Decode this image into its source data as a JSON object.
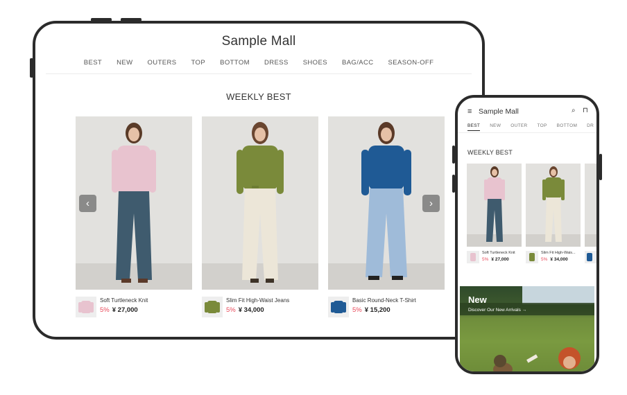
{
  "tablet": {
    "logo": "Sample Mall",
    "nav": [
      "BEST",
      "NEW",
      "OUTERS",
      "TOP",
      "BOTTOM",
      "DRESS",
      "SHOES",
      "BAG/ACC",
      "SEASON-OFF"
    ],
    "heading": "WEEKLY BEST",
    "prev_icon": "‹",
    "next_icon": "›",
    "products": [
      {
        "name": "Soft Turtleneck Knit",
        "discount": "5%",
        "price": "¥ 27,000",
        "top_color": "#e8c3cf",
        "bottom_color": "#3f5b6e"
      },
      {
        "name": "Slim Fit High-Waist Jeans",
        "discount": "5%",
        "price": "¥ 34,000",
        "top_color": "#7a8a3a",
        "bottom_color": "#ece6d8"
      },
      {
        "name": "Basic Round-Neck T-Shirt",
        "discount": "5%",
        "price": "¥ 15,200",
        "top_color": "#1f5a95",
        "bottom_color": "#9fbbd9"
      }
    ]
  },
  "phone": {
    "menu_icon": "≡",
    "logo": "Sample Mall",
    "search_icon": "⌕",
    "cart_icon": "⊓",
    "nav": [
      "BEST",
      "NEW",
      "OUTER",
      "TOP",
      "BOTTOM",
      "DR"
    ],
    "heading": "WEEKLY BEST",
    "products": [
      {
        "name": "Soft Turtleneck Knit",
        "discount": "5%",
        "price": "¥ 27,000"
      },
      {
        "name": "Slim Fit High-Wais...",
        "discount": "5%",
        "price": "¥ 34,000"
      },
      {
        "name": "",
        "discount": "",
        "price": ""
      }
    ],
    "banner": {
      "title": "New",
      "subtitle": "Discover Our New Arrivals →"
    }
  }
}
